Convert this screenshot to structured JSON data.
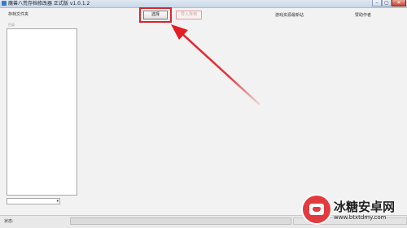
{
  "window": {
    "title": "魔兽八荒存档修改器 正式版 v1.0.1.2",
    "controls": {
      "minimize": "–",
      "maximize": "▢",
      "close": "✕"
    }
  },
  "toolbar": {
    "section_label": "存档文件夹",
    "select_label": "选择",
    "import_label": "导入存档",
    "website_link": "游戏资源最新站",
    "author_link": "赞助作者"
  },
  "left_panel": {
    "caption": "目录",
    "dropdown_value": "",
    "dropdown_arrow": "▾"
  },
  "statusbar": {
    "label": "状态:"
  },
  "annotation": {
    "highlight_color": "#d8262c",
    "arrow_color": "#e31d25"
  },
  "watermark": {
    "title": "冰糖安卓网",
    "url": "www.btxtdmy.com",
    "color": "#e23b3f"
  }
}
